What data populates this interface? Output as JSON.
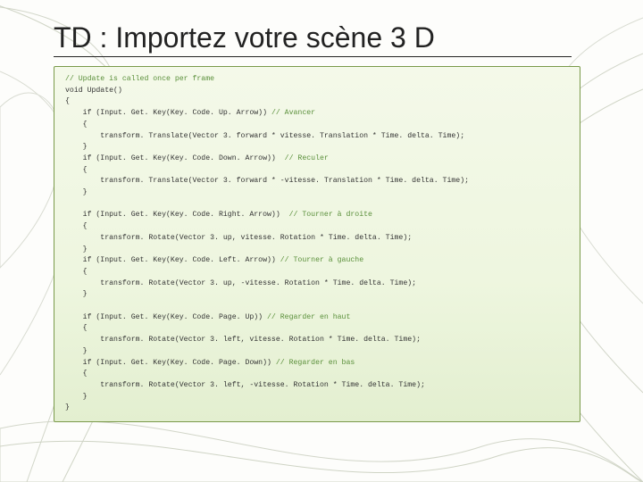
{
  "title": "TD : Importez votre scène 3 D",
  "code": {
    "l1_comment": "// Update is called once per frame",
    "l2": "void Update()",
    "l3": "{",
    "l4": "    if (Input. Get. Key(Key. Code. Up. Arrow)) ",
    "l4_comment": "// Avancer",
    "l5": "    {",
    "l6": "        transform. Translate(Vector 3. forward * vitesse. Translation * Time. delta. Time);",
    "l7": "    }",
    "l8": "    if (Input. Get. Key(Key. Code. Down. Arrow))  ",
    "l8_comment": "// Reculer",
    "l9": "    {",
    "l10": "        transform. Translate(Vector 3. forward * -vitesse. Translation * Time. delta. Time);",
    "l11": "    }",
    "blank1": "",
    "l12": "    if (Input. Get. Key(Key. Code. Right. Arrow))  ",
    "l12_comment": "// Tourner à droite",
    "l13": "    {",
    "l14": "        transform. Rotate(Vector 3. up, vitesse. Rotation * Time. delta. Time);",
    "l15": "    }",
    "l16": "    if (Input. Get. Key(Key. Code. Left. Arrow)) ",
    "l16_comment": "// Tourner à gauche",
    "l17": "    {",
    "l18": "        transform. Rotate(Vector 3. up, -vitesse. Rotation * Time. delta. Time);",
    "l19": "    }",
    "blank2": "",
    "l20": "    if (Input. Get. Key(Key. Code. Page. Up)) ",
    "l20_comment": "// Regarder en haut",
    "l21": "    {",
    "l22": "        transform. Rotate(Vector 3. left, vitesse. Rotation * Time. delta. Time);",
    "l23": "    }",
    "l24": "    if (Input. Get. Key(Key. Code. Page. Down)) ",
    "l24_comment": "// Regarder en bas",
    "l25": "    {",
    "l26": "        transform. Rotate(Vector 3. left, -vitesse. Rotation * Time. delta. Time);",
    "l27": "    }",
    "l28": "}"
  }
}
